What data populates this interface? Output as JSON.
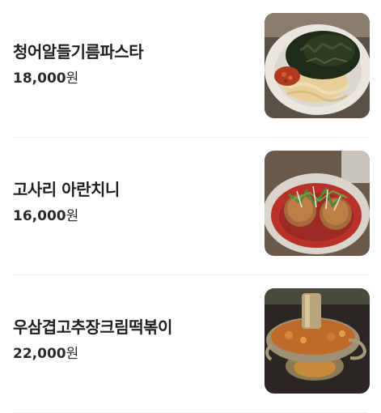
{
  "menu": {
    "items": [
      {
        "name": "청어알들기름파스타",
        "price": "18,000",
        "currency": "원",
        "image": "pasta-photo"
      },
      {
        "name": "고사리 아란치니",
        "price": "16,000",
        "currency": "원",
        "image": "arancini-photo"
      },
      {
        "name": "우삼겹고추장크림떡볶이",
        "price": "22,000",
        "currency": "원",
        "image": "tteokbokki-hotpot-photo"
      }
    ]
  }
}
